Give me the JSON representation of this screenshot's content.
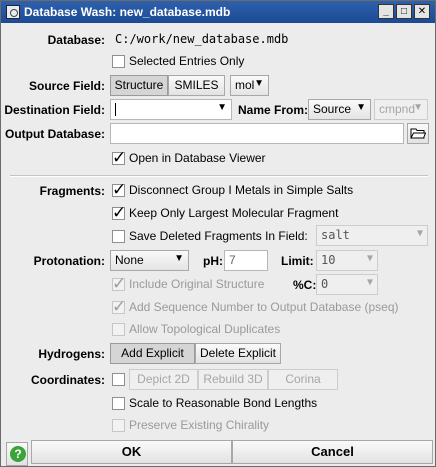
{
  "window": {
    "title": "Database Wash: new_database.mdb",
    "minimize": "_",
    "maximize": "□",
    "close": "✕"
  },
  "database": {
    "label": "Database:",
    "value": "C:/work/new_database.mdb"
  },
  "selected_entries": {
    "label": "Selected Entries Only",
    "checked": false
  },
  "source_field": {
    "label": "Source Field:",
    "options": [
      "Structure",
      "SMILES"
    ],
    "selected": "Structure",
    "format": "mol"
  },
  "destination": {
    "label": "Destination Field:",
    "value": "",
    "name_from_label": "Name From:",
    "name_from_value": "Source",
    "extra_value": "cmpnd"
  },
  "output": {
    "label": "Output Database:",
    "value": ""
  },
  "open_viewer": {
    "label": "Open in Database Viewer",
    "checked": true
  },
  "fragments": {
    "label": "Fragments:",
    "disconnect": "Disconnect Group I Metals in Simple Salts",
    "keep_largest": "Keep Only Largest Molecular Fragment",
    "save_deleted": "Save Deleted Fragments In Field:",
    "save_field": "salt"
  },
  "protonation": {
    "label": "Protonation:",
    "value": "None",
    "ph_label": "pH:",
    "ph_value": "7",
    "limit_label": "Limit:",
    "limit_value": "10",
    "include_original": "Include Original Structure",
    "pc_label": "%C:",
    "pc_value": "0",
    "add_sequence": "Add Sequence Number to Output Database (pseq)",
    "allow_duplicates": "Allow Topological Duplicates"
  },
  "hydrogens": {
    "label": "Hydrogens:",
    "add": "Add Explicit",
    "delete": "Delete Explicit",
    "selected": "Add Explicit"
  },
  "coordinates": {
    "label": "Coordinates:",
    "depict": "Depict 2D",
    "rebuild": "Rebuild 3D",
    "corina": "Corina",
    "scale": "Scale to Reasonable Bond Lengths",
    "preserve": "Preserve Existing Chirality"
  },
  "footer": {
    "help": "?",
    "ok": "OK",
    "cancel": "Cancel"
  }
}
